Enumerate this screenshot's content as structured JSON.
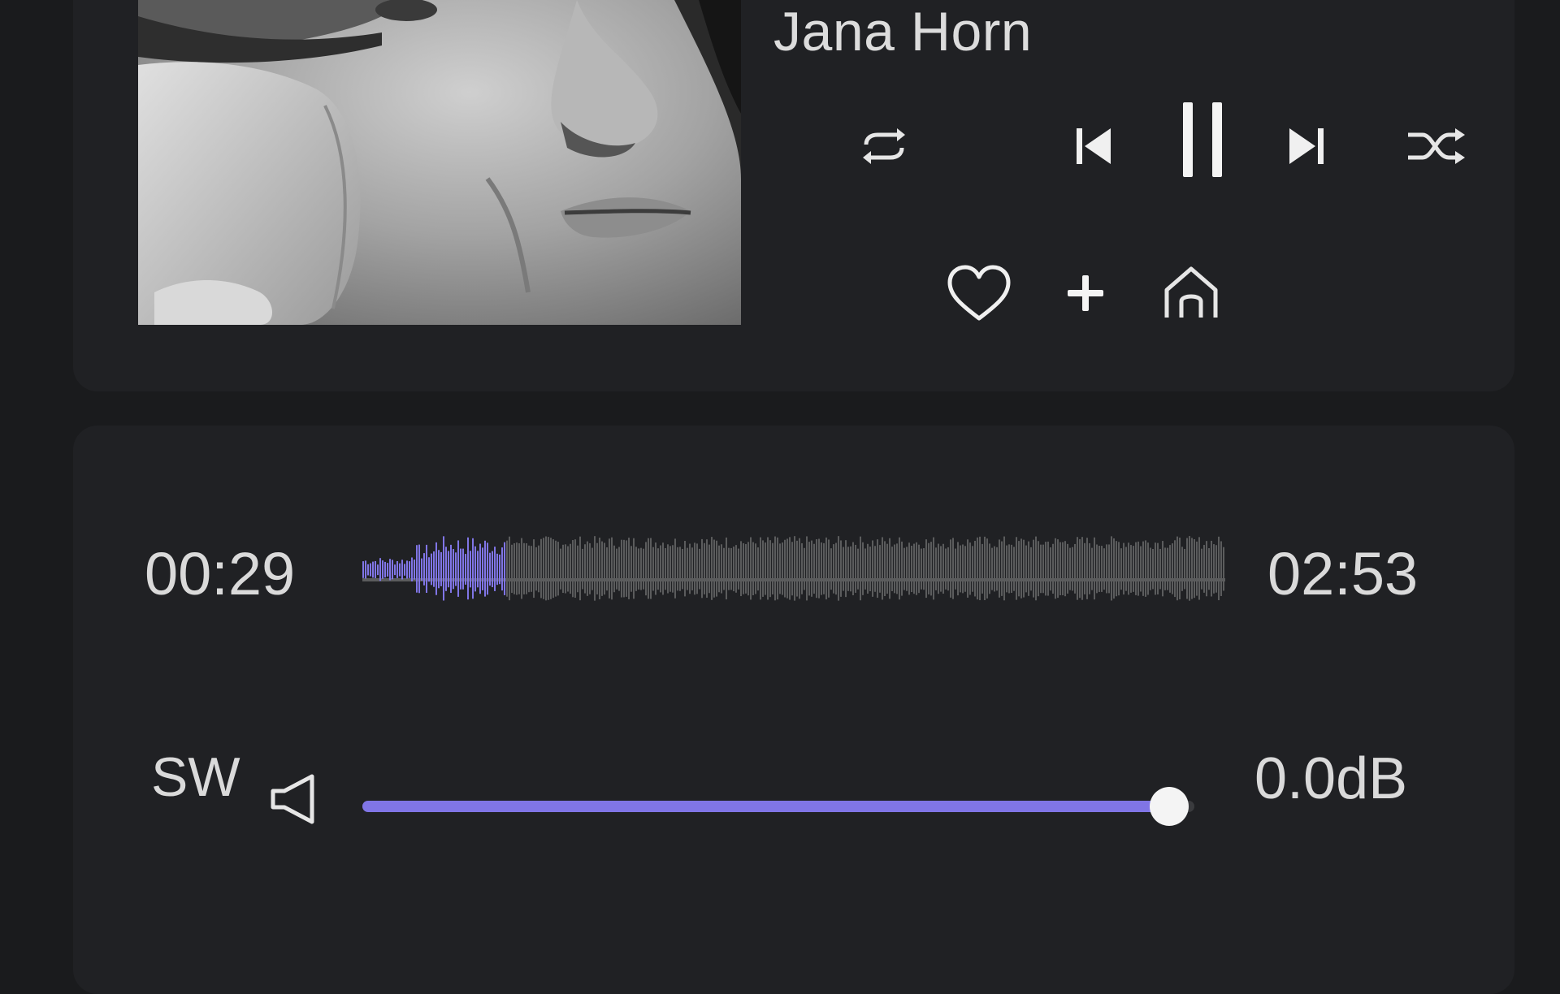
{
  "now_playing": {
    "artist": "Jana Horn"
  },
  "playback": {
    "elapsed": "00:29",
    "total": "02:53",
    "progress_fraction": 0.165
  },
  "output": {
    "label": "SW",
    "volume_readout": "0.0dB",
    "volume_fraction": 0.97
  },
  "icons": {
    "repeat": "repeat-icon",
    "previous": "skip-previous-icon",
    "pause": "pause-icon",
    "next": "skip-next-icon",
    "shuffle": "shuffle-icon",
    "favorite": "heart-icon",
    "add": "plus-icon",
    "home": "home-icon",
    "speaker": "speaker-icon"
  },
  "colors": {
    "accent": "#8075e6",
    "waveform_unplayed": "#5b5c5d",
    "card": "#202124",
    "background": "#1a1b1d"
  }
}
